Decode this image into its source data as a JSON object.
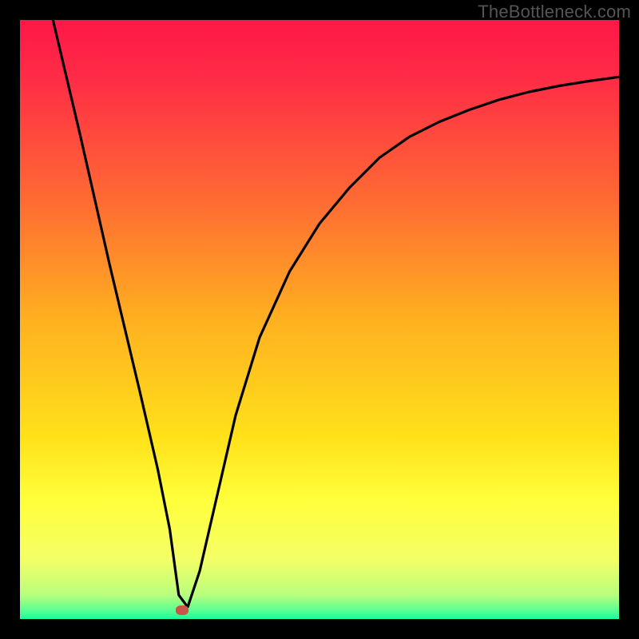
{
  "watermark": "TheBottleneck.com",
  "chart_data": {
    "type": "line",
    "title": "",
    "xlabel": "",
    "ylabel": "",
    "xlim": [
      0,
      100
    ],
    "ylim": [
      0,
      100
    ],
    "gradient_stops": [
      {
        "offset": 0,
        "color": "#ff1748"
      },
      {
        "offset": 0.1,
        "color": "#ff2d46"
      },
      {
        "offset": 0.3,
        "color": "#ff6a33"
      },
      {
        "offset": 0.5,
        "color": "#ffb020"
      },
      {
        "offset": 0.7,
        "color": "#ffe21a"
      },
      {
        "offset": 0.8,
        "color": "#ffff3a"
      },
      {
        "offset": 0.9,
        "color": "#f4ff66"
      },
      {
        "offset": 0.96,
        "color": "#b8ff7d"
      },
      {
        "offset": 0.985,
        "color": "#5dff93"
      },
      {
        "offset": 1.0,
        "color": "#18ff9b"
      }
    ],
    "series": [
      {
        "name": "bottleneck-curve",
        "x": [
          5.5,
          10,
          15,
          20,
          23,
          25,
          26.5,
          28,
          30,
          33,
          36,
          40,
          45,
          50,
          55,
          60,
          65,
          70,
          75,
          80,
          85,
          90,
          95,
          100
        ],
        "y": [
          100,
          81,
          59,
          38,
          25,
          15,
          4,
          2,
          8,
          21,
          34,
          47,
          58,
          66,
          72,
          77,
          80.5,
          83,
          85,
          86.7,
          88,
          89,
          89.8,
          90.5
        ]
      }
    ],
    "marker": {
      "x": 27,
      "y": 1.5,
      "color": "#c8544a"
    }
  }
}
